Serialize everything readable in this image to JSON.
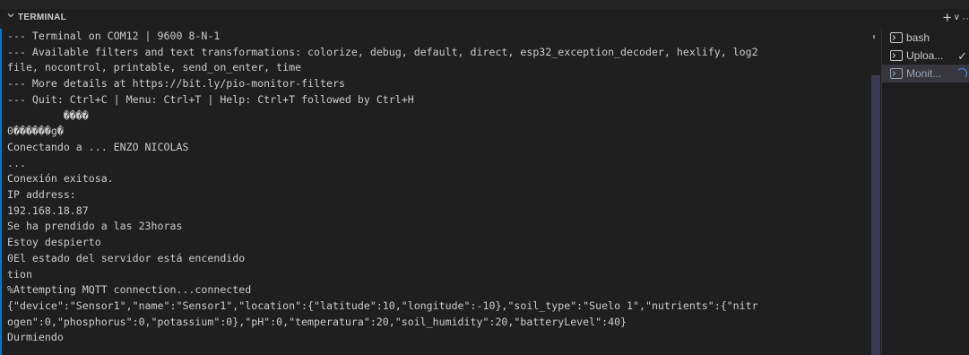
{
  "panel": {
    "title": "TERMINAL",
    "add_label": "+",
    "dropdown_label": "∨",
    "more_label": "··"
  },
  "terminal": {
    "lines": [
      "--- Terminal on COM12 | 9600 8-N-1",
      "--- Available filters and text transformations: colorize, debug, default, direct, esp32_exception_decoder, hexlify, log2",
      "file, nocontrol, printable, send_on_enter, time",
      "--- More details at https://bit.ly/pio-monitor-filters",
      "--- Quit: Ctrl+C | Menu: Ctrl+T | Help: Ctrl+T followed by Ctrl+H",
      "         ����",
      "0������g�",
      "Conectando a ... ENZO NICOLAS",
      "...",
      "Conexión exitosa.",
      "IP address:",
      "192.168.18.87",
      "Se ha prendido a las 23horas",
      "Estoy despierto",
      "0El estado del servidor está encendido",
      "tion",
      "%Attempting MQTT connection...connected",
      "{\"device\":\"Sensor1\",\"name\":\"Sensor1\",\"location\":{\"latitude\":10,\"longitude\":-10},\"soil_type\":\"Suelo 1\",\"nutrients\":{\"nitr",
      "ogen\":0,\"phosphorus\":0,\"potassium\":0},\"pH\":0,\"temperatura\":20,\"soil_humidity\":20,\"batteryLevel\":40}",
      "Durmiendo"
    ]
  },
  "terminal_tabs": [
    {
      "label": "bash",
      "icon": "terminal-icon",
      "status": ""
    },
    {
      "label": "Uploa...",
      "icon": "terminal-icon",
      "status": "✓",
      "status_icon": "check-icon"
    },
    {
      "label": "Monit...",
      "icon": "terminal-icon",
      "status": "",
      "status_icon": "spinner-icon"
    }
  ],
  "colors": {
    "background": "#1e1e1e",
    "text": "#cccccc",
    "accent": "#007acc",
    "active_tab": "#37373d"
  }
}
